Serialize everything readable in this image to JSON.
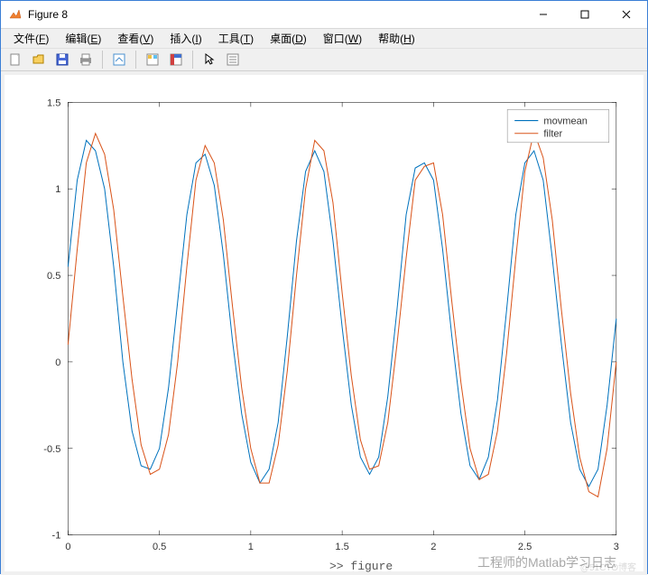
{
  "window": {
    "title": "Figure 8"
  },
  "menu": {
    "file": "文件(F)",
    "edit": "编辑(E)",
    "view": "查看(V)",
    "insert": "插入(I)",
    "tools": "工具(T)",
    "desktop": "桌面(D)",
    "windowm": "窗口(W)",
    "help": "帮助(H)"
  },
  "toolbar_icons": {
    "new": "new-icon",
    "open": "open-icon",
    "save": "save-icon",
    "print": "print-icon",
    "link": "link-icon",
    "prefs": "palette-icon",
    "dock": "dock-icon",
    "insp": "insp-icon",
    "arrow": "arrow-icon",
    "data": "data-icon"
  },
  "legend": {
    "s1": "movmean",
    "s2": "filter"
  },
  "axes": {
    "x_ticks": [
      0,
      0.5,
      1,
      1.5,
      2,
      2.5,
      3
    ],
    "y_ticks": [
      -1,
      -0.5,
      0,
      0.5,
      1,
      1.5
    ]
  },
  "watermark": "工程师的Matlab学习日志",
  "watermark2": "@51CTO博客",
  "bottom": ">> figure",
  "chart_data": {
    "type": "line",
    "xlabel": "",
    "ylabel": "",
    "xlim": [
      0,
      3
    ],
    "ylim": [
      -1,
      1.5
    ],
    "series": [
      {
        "name": "movmean",
        "color": "#0072BD",
        "x": [
          0,
          0.05,
          0.1,
          0.15,
          0.2,
          0.25,
          0.3,
          0.35,
          0.4,
          0.45,
          0.5,
          0.55,
          0.6,
          0.65,
          0.7,
          0.75,
          0.8,
          0.85,
          0.9,
          0.95,
          1,
          1.05,
          1.1,
          1.15,
          1.2,
          1.25,
          1.3,
          1.35,
          1.4,
          1.45,
          1.5,
          1.55,
          1.6,
          1.65,
          1.7,
          1.75,
          1.8,
          1.85,
          1.9,
          1.95,
          2,
          2.05,
          2.1,
          2.15,
          2.2,
          2.25,
          2.3,
          2.35,
          2.4,
          2.45,
          2.5,
          2.55,
          2.6,
          2.65,
          2.7,
          2.75,
          2.8,
          2.85,
          2.9,
          2.95,
          3
        ],
        "y": [
          0.55,
          1.05,
          1.28,
          1.22,
          1.0,
          0.55,
          0.0,
          -0.4,
          -0.6,
          -0.62,
          -0.5,
          -0.15,
          0.35,
          0.85,
          1.15,
          1.2,
          1.02,
          0.62,
          0.12,
          -0.3,
          -0.58,
          -0.7,
          -0.62,
          -0.35,
          0.15,
          0.7,
          1.1,
          1.22,
          1.1,
          0.7,
          0.2,
          -0.25,
          -0.55,
          -0.65,
          -0.55,
          -0.2,
          0.3,
          0.85,
          1.12,
          1.15,
          1.05,
          0.65,
          0.15,
          -0.3,
          -0.6,
          -0.68,
          -0.55,
          -0.22,
          0.3,
          0.85,
          1.15,
          1.22,
          1.05,
          0.6,
          0.1,
          -0.35,
          -0.62,
          -0.72,
          -0.62,
          -0.25,
          0.25
        ]
      },
      {
        "name": "filter",
        "color": "#D95319",
        "x": [
          0,
          0.05,
          0.1,
          0.15,
          0.2,
          0.25,
          0.3,
          0.35,
          0.4,
          0.45,
          0.5,
          0.55,
          0.6,
          0.65,
          0.7,
          0.75,
          0.8,
          0.85,
          0.9,
          0.95,
          1,
          1.05,
          1.1,
          1.15,
          1.2,
          1.25,
          1.3,
          1.35,
          1.4,
          1.45,
          1.5,
          1.55,
          1.6,
          1.65,
          1.7,
          1.75,
          1.8,
          1.85,
          1.9,
          1.95,
          2,
          2.05,
          2.1,
          2.15,
          2.2,
          2.25,
          2.3,
          2.35,
          2.4,
          2.45,
          2.5,
          2.55,
          2.6,
          2.65,
          2.7,
          2.75,
          2.8,
          2.85,
          2.9,
          2.95,
          3
        ],
        "y": [
          0.1,
          0.65,
          1.15,
          1.32,
          1.2,
          0.88,
          0.38,
          -0.1,
          -0.48,
          -0.65,
          -0.62,
          -0.42,
          0.0,
          0.55,
          1.05,
          1.25,
          1.15,
          0.82,
          0.32,
          -0.15,
          -0.5,
          -0.7,
          -0.7,
          -0.48,
          -0.05,
          0.5,
          1.0,
          1.28,
          1.22,
          0.92,
          0.4,
          -0.08,
          -0.45,
          -0.62,
          -0.6,
          -0.35,
          0.1,
          0.6,
          1.05,
          1.13,
          1.15,
          0.85,
          0.35,
          -0.12,
          -0.5,
          -0.68,
          -0.65,
          -0.4,
          0.05,
          0.6,
          1.1,
          1.33,
          1.18,
          0.82,
          0.3,
          -0.18,
          -0.55,
          -0.75,
          -0.78,
          -0.5,
          0.0
        ]
      }
    ]
  }
}
